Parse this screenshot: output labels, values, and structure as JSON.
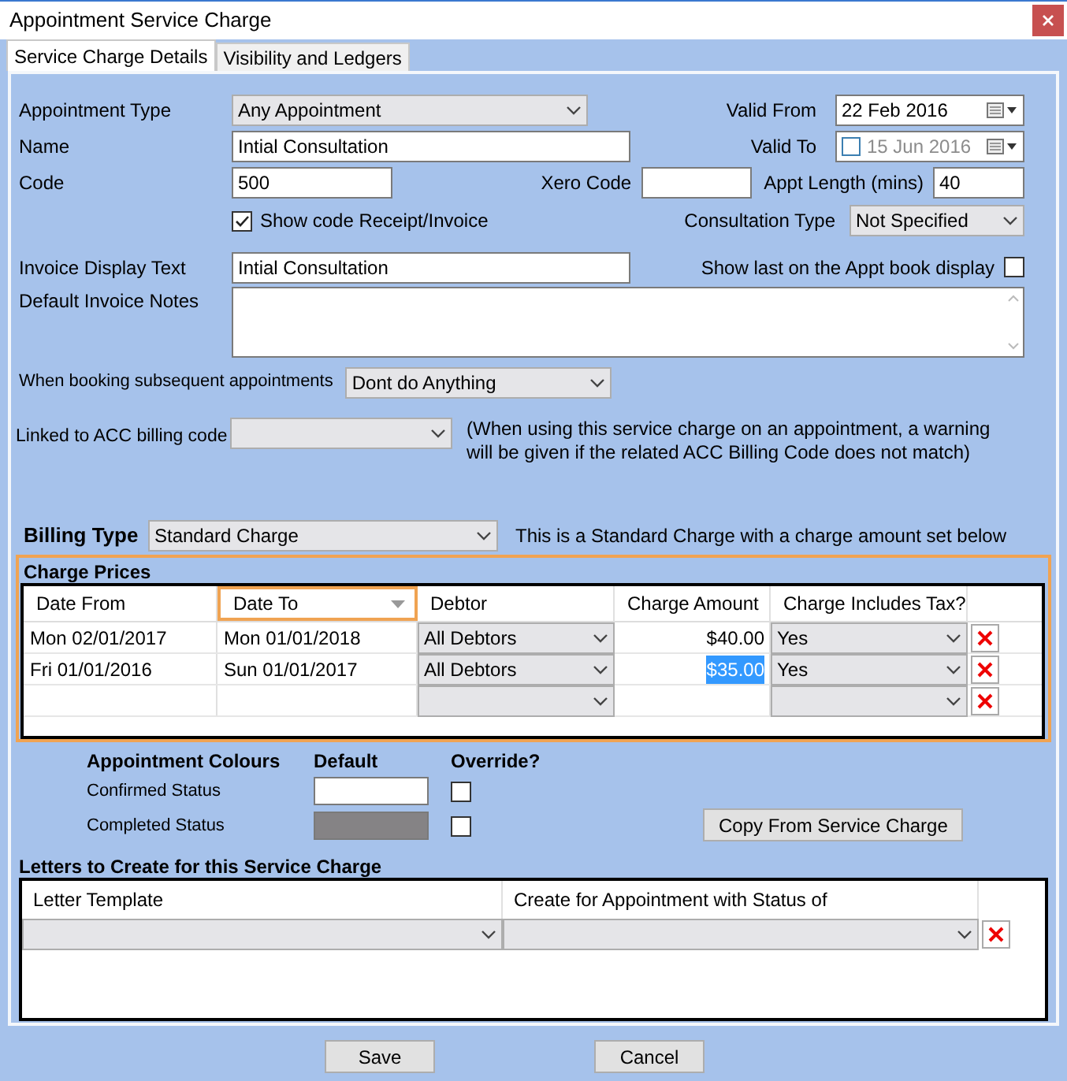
{
  "window": {
    "title": "Appointment Service Charge"
  },
  "tabs": [
    {
      "label": "Service Charge Details",
      "selected": true
    },
    {
      "label": "Visibility and Ledgers",
      "selected": false
    }
  ],
  "appointment_type": {
    "label": "Appointment Type",
    "value": "Any Appointment"
  },
  "valid_from": {
    "label": "Valid From",
    "value": "22 Feb 2016"
  },
  "name": {
    "label": "Name",
    "value": "Intial Consultation"
  },
  "valid_to": {
    "label": "Valid To",
    "value": "15 Jun 2016",
    "checked": false
  },
  "code": {
    "label": "Code",
    "value": "500"
  },
  "xero_code": {
    "label": "Xero Code"
  },
  "appt_length": {
    "label": "Appt Length (mins)",
    "value": "40"
  },
  "show_code": {
    "label": "Show code Receipt/Invoice",
    "checked": true
  },
  "consultation_type": {
    "label": "Consultation Type",
    "value": "Not Specified"
  },
  "invoice_display_text": {
    "label": "Invoice Display Text",
    "value": "Intial Consultation"
  },
  "show_last": {
    "label": "Show last on the Appt book display",
    "checked": false
  },
  "default_invoice_notes": {
    "label": "Default Invoice Notes"
  },
  "subsequent": {
    "label": "When booking subsequent appointments",
    "value": "Dont do Anything"
  },
  "acc_code": {
    "label": "Linked to ACC billing code",
    "note": "(When using this service charge on an appointment, a warning will be given if the related ACC Billing Code does not match)"
  },
  "billing_type": {
    "label": "Billing Type",
    "value": "Standard Charge",
    "note": "This is a Standard Charge with a charge amount set below"
  },
  "charge_prices": {
    "title": "Charge Prices",
    "columns": [
      {
        "label": "Date From",
        "selected": false
      },
      {
        "label": "Date To",
        "selected": true
      },
      {
        "label": "Debtor",
        "selected": false
      },
      {
        "label": "Charge Amount",
        "selected": false
      },
      {
        "label": "Charge Includes Tax?",
        "selected": false
      }
    ],
    "rows": [
      {
        "kind": "entry",
        "date_from": "Mon 02/01/2017",
        "date_to": "Mon 01/01/2018",
        "debtor": "All Debtors",
        "amount": "$40.00",
        "amount_selected": false,
        "tax": "Yes"
      },
      {
        "kind": "entry",
        "date_from": "Fri 01/01/2016",
        "date_to": "Sun 01/01/2017",
        "debtor": "All Debtors",
        "amount": "$35.00",
        "amount_selected": true,
        "tax": "Yes"
      },
      {
        "kind": "new"
      }
    ]
  },
  "colours": {
    "title": "Appointment Colours",
    "default_heading": "Default",
    "override_heading": "Override?",
    "rows": [
      {
        "label": "Confirmed Status",
        "color": "#ffffff",
        "override": false
      },
      {
        "label": "Completed Status",
        "color": "#858385",
        "override": false
      }
    ],
    "copy_button": "Copy From Service Charge"
  },
  "letters": {
    "title": "Letters to Create for this Service Charge",
    "columns": [
      "Letter Template",
      "Create for Appointment with Status of"
    ],
    "rows": [
      {
        "kind": "new"
      }
    ]
  },
  "buttons": [
    "Save",
    "Cancel"
  ]
}
